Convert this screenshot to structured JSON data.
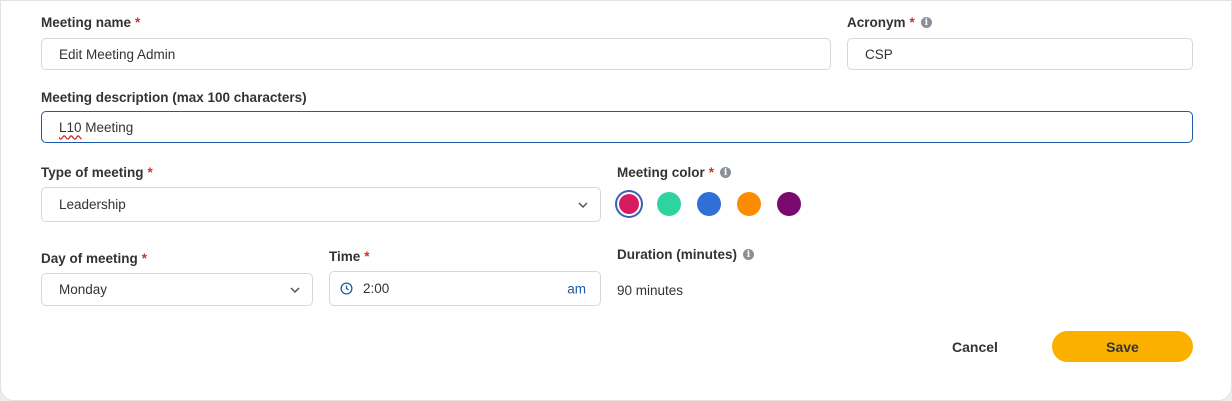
{
  "form": {
    "meeting_name": {
      "label": "Meeting name",
      "required": "*",
      "value": "Edit Meeting Admin"
    },
    "acronym": {
      "label": "Acronym",
      "required": "*",
      "info_icon": "info-icon",
      "value": "CSP"
    },
    "description": {
      "label": "Meeting description (max 100 characters)",
      "value_misspelled": "L10",
      "value_rest": " Meeting"
    },
    "type": {
      "label": "Type of meeting",
      "required": "*",
      "value": "Leadership",
      "icon": "chevron-down-icon"
    },
    "color": {
      "label": "Meeting color",
      "required": "*",
      "info_icon": "info-icon",
      "options": [
        "#d81b60",
        "#2fd3a0",
        "#2f6fd6",
        "#fb8c00",
        "#7b0a6e"
      ],
      "selected_index": 0
    },
    "day": {
      "label": "Day of meeting",
      "required": "*",
      "value": "Monday",
      "icon": "chevron-down-icon"
    },
    "time": {
      "label": "Time",
      "required": "*",
      "value": "2:00",
      "ampm": "am",
      "icon": "clock-icon"
    },
    "duration": {
      "label": "Duration (minutes)",
      "info_icon": "info-icon",
      "value": "90 minutes"
    }
  },
  "actions": {
    "cancel_label": "Cancel",
    "save_label": "Save"
  },
  "colors": {
    "accent": "#fbb000",
    "focus": "#1f5aa8",
    "required": "#d0312d"
  }
}
